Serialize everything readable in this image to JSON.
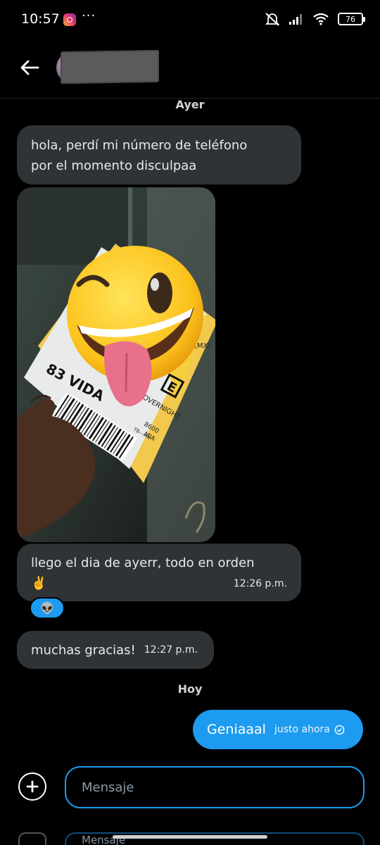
{
  "status_bar": {
    "time": "10:57",
    "more": "···",
    "battery": "76"
  },
  "header": {
    "contact_name": ""
  },
  "days": {
    "yesterday": "Ayer",
    "today": "Hoy"
  },
  "messages": {
    "m1": {
      "line1": "hola, perdí mi número de teléfono",
      "line2": "por el momento disculpaa"
    },
    "m3": {
      "line1": "llego el dia de ayerr,  todo en orden",
      "emoji": "✌️",
      "time": "12:26 p.m.",
      "reaction": "👽"
    },
    "m4": {
      "text": "muchas gracias!",
      "time": "12:27 p.m."
    },
    "m5": {
      "text": "Geniaaal",
      "time": "justo ahora"
    }
  },
  "photo": {
    "emoji": "😜",
    "label_number": "83 VIDA",
    "label_service": "OVERNIGHT",
    "label_code": "(MX)",
    "label_box": "E",
    "label_small1": "TB—MX",
    "label_small2": "8600",
    "label_small3": "MIA"
  },
  "composer": {
    "placeholder": "Mensaje",
    "ghost_text": "Mensaje"
  },
  "colors": {
    "accent": "#1d9bf0",
    "bubble_in": "#2f3336",
    "background": "#000000"
  }
}
